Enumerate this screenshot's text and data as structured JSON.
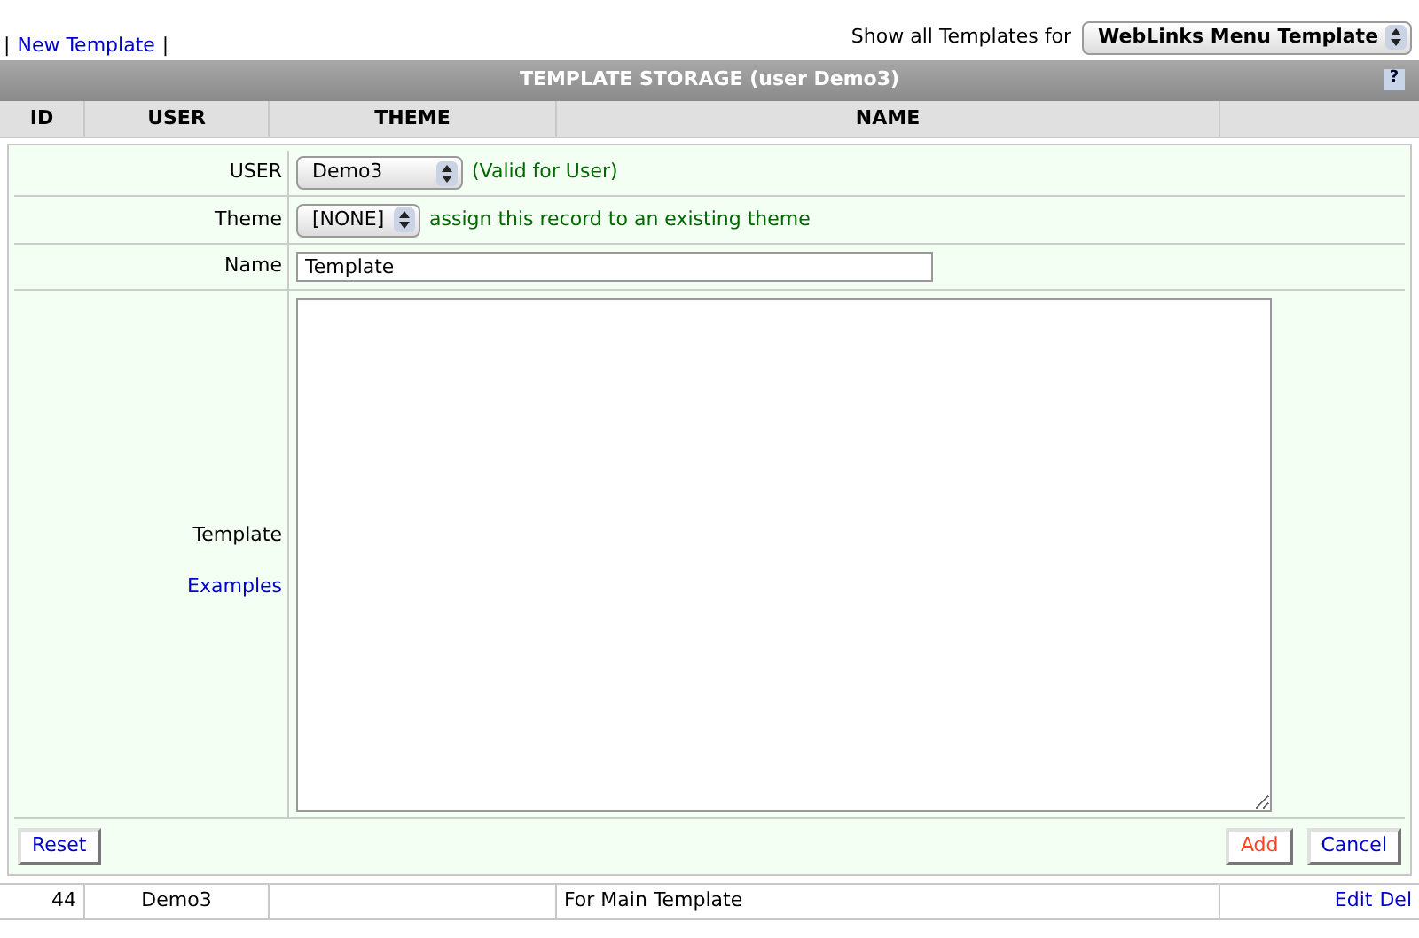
{
  "top_links": {
    "separator_left": "|",
    "new_template": "New Template",
    "separator_right": "|"
  },
  "filter": {
    "label": "Show all Templates for",
    "value": "WebLinks Menu Template"
  },
  "panel": {
    "title": "TEMPLATE STORAGE (user Demo3)",
    "help": "?"
  },
  "table": {
    "columns": [
      "ID",
      "USER",
      "THEME",
      "NAME"
    ],
    "rows": [
      {
        "id": "44",
        "user": "Demo3",
        "name": "For Main Template",
        "actions": [
          "Edit",
          "Del"
        ]
      }
    ]
  },
  "form": {
    "user": {
      "label": "USER",
      "value": "Demo3",
      "note": "(Valid for User)"
    },
    "theme": {
      "label": "Theme",
      "value": "[NONE]",
      "note": "assign this record to an existing theme"
    },
    "name": {
      "label": "Name",
      "value": "Template"
    },
    "template": {
      "label": "Template",
      "link": "Examples"
    },
    "buttons": [
      {
        "label": "Reset",
        "kind": "reset"
      },
      {
        "label": "Add",
        "kind": "submit"
      },
      {
        "label": "Cancel",
        "kind": "cancel"
      }
    ]
  }
}
